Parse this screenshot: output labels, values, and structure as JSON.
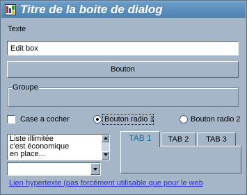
{
  "window": {
    "title": "Titre de la boite de dialog",
    "icon": "app-icon"
  },
  "texte_label": "Texte",
  "editbox": {
    "value": "Edit box"
  },
  "bouton": {
    "label": "Bouton"
  },
  "groupe": {
    "label": "Groupe"
  },
  "checkbox": {
    "label": "Case a cocher",
    "checked": false
  },
  "radios": [
    {
      "label": "Bouton radio 1",
      "selected": true
    },
    {
      "label": "Bouton radio 2",
      "selected": false
    }
  ],
  "listbox": {
    "items": [
      "Liste illimitée",
      "c'est économique",
      "en place..."
    ]
  },
  "combobox": {
    "value": ""
  },
  "tabs": [
    {
      "label": "TAB 1",
      "active": true
    },
    {
      "label": "TAB 2",
      "active": false
    },
    {
      "label": "TAB 3",
      "active": false
    }
  ],
  "link": {
    "text": "Lien hypertexte (pas forcément utilisable que pour le web"
  },
  "colors": {
    "dialog_bg": "#a4b6c8",
    "title_bar": "#5a8cbe",
    "active_tab_text": "#1a6a8c",
    "link": "#2c2ce0"
  }
}
